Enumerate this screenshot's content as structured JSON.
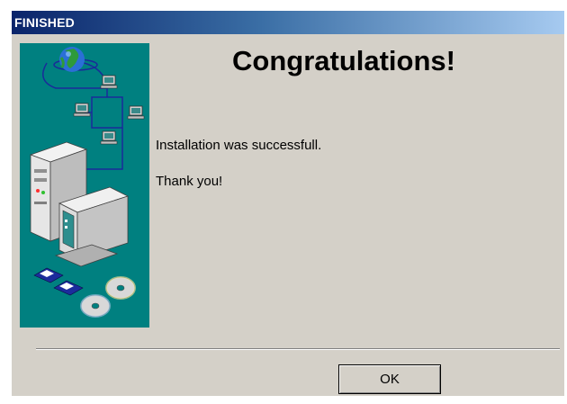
{
  "window": {
    "title": "FINISHED"
  },
  "content": {
    "heading": "Congratulations!",
    "message_line1": "Installation was successfull.",
    "message_line2": "Thank you!"
  },
  "buttons": {
    "ok_label": "OK"
  },
  "colors": {
    "dialog_background": "#d4d0c8",
    "title_bar_start": "#0a246a",
    "title_bar_end": "#a6caf0",
    "side_panel": "#008080"
  },
  "icons": {
    "side_illustration": [
      "globe-icon",
      "network-computer-icon",
      "desktop-computer-icon",
      "floppy-disk-icon",
      "cd-disc-icon"
    ]
  }
}
